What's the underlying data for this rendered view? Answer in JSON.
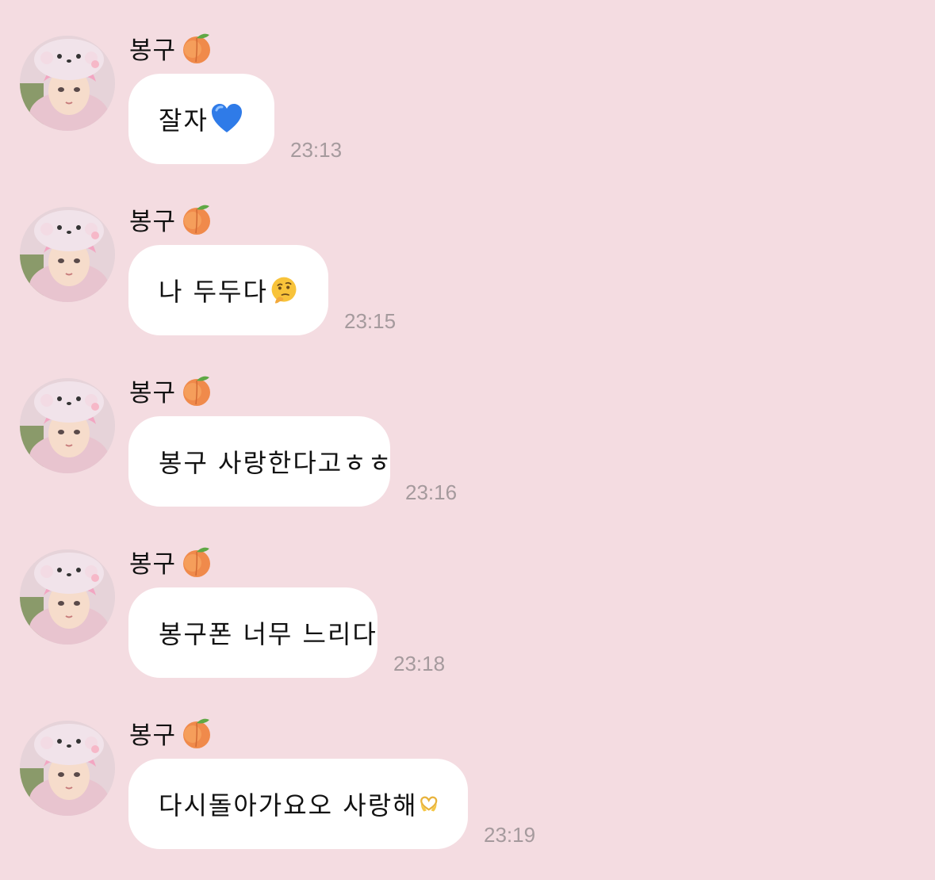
{
  "chat": {
    "messages": [
      {
        "sender": "봉구",
        "sender_emoji": "peach-icon",
        "text": "잘자",
        "emoji": "blue-heart-icon",
        "time": "23:13"
      },
      {
        "sender": "봉구",
        "sender_emoji": "peach-icon",
        "text": "나 두두다",
        "emoji": "thinking-face-icon",
        "time": "23:15"
      },
      {
        "sender": "봉구",
        "sender_emoji": "peach-icon",
        "text": "봉구 사랑한다고ㅎㅎ",
        "emoji": "",
        "time": "23:16"
      },
      {
        "sender": "봉구",
        "sender_emoji": "peach-icon",
        "text": "봉구폰 너무 느리다",
        "emoji": "",
        "time": "23:18"
      },
      {
        "sender": "봉구",
        "sender_emoji": "peach-icon",
        "text": "다시돌아가요오 사랑해",
        "emoji": "heart-hands-icon",
        "time": "23:19"
      }
    ]
  },
  "colors": {
    "background": "#f4dce1",
    "bubble": "#ffffff",
    "timestamp": "#a59a9d",
    "text": "#111111"
  }
}
